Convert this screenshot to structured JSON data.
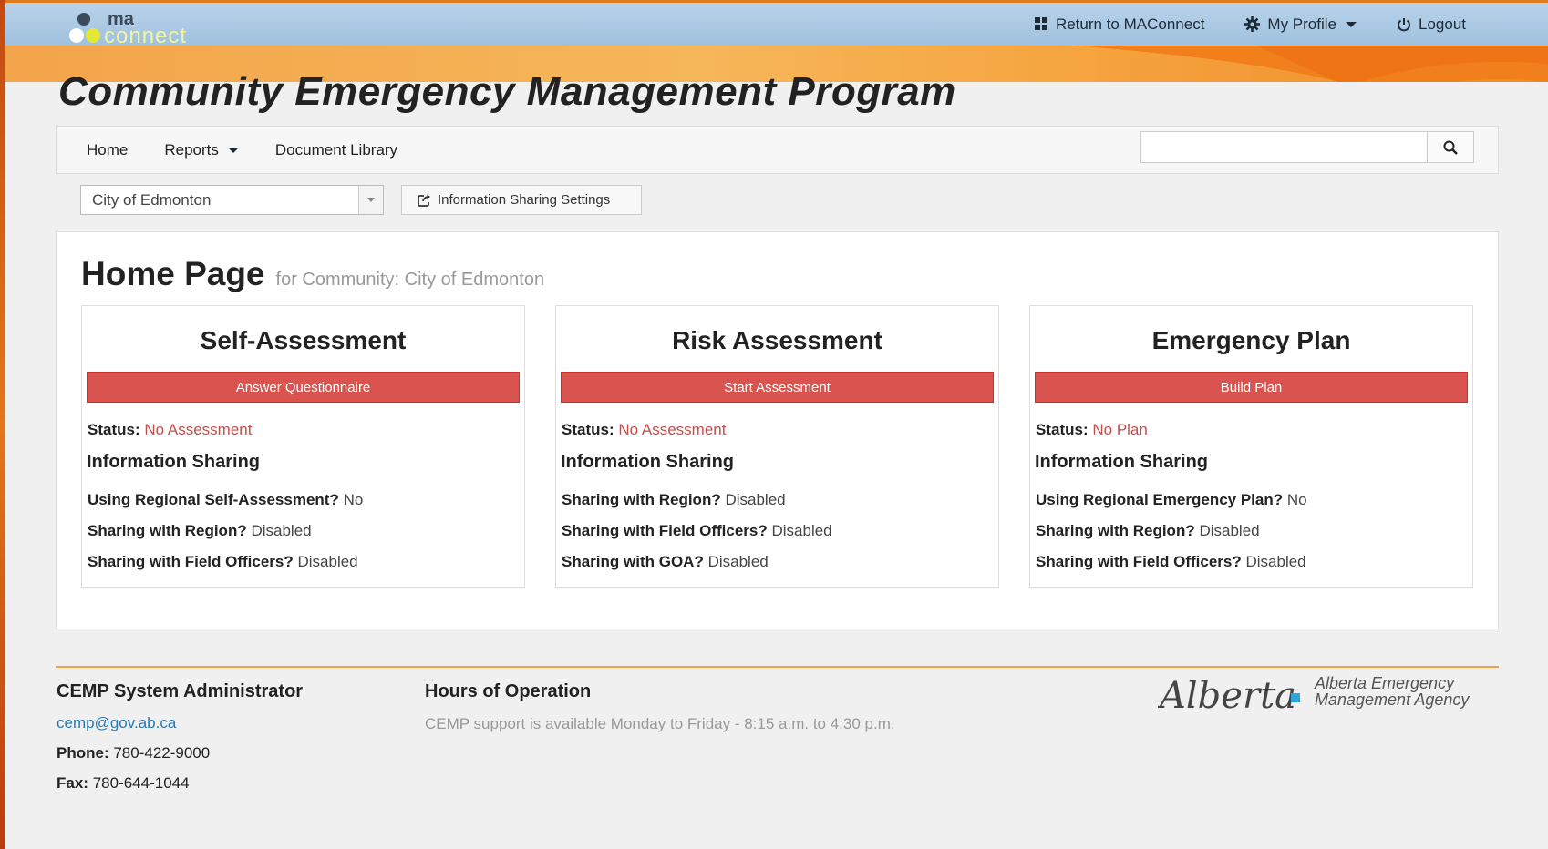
{
  "topbar": {
    "logo_text_top": "ma",
    "logo_text_bottom": "connect",
    "return_label": "Return to MAConnect",
    "profile_label": "My Profile",
    "logout_label": "Logout"
  },
  "app_title": "Community Emergency Management Program",
  "navbar": {
    "home": "Home",
    "reports": "Reports",
    "document_library": "Document Library",
    "search_placeholder": ""
  },
  "controls": {
    "community_selected": "City of Edmonton",
    "sharing_settings_label": "Information Sharing Settings"
  },
  "page": {
    "title": "Home Page",
    "subtitle": "for Community: City of Edmonton"
  },
  "cards": [
    {
      "title": "Self-Assessment",
      "action": "Answer Questionnaire",
      "status_label": "Status:",
      "status_value": "No Assessment",
      "info_heading": "Information Sharing",
      "rows": [
        {
          "label": "Using Regional Self-Assessment?",
          "value": "No"
        },
        {
          "label": "Sharing with Region?",
          "value": "Disabled"
        },
        {
          "label": "Sharing with Field Officers?",
          "value": "Disabled"
        }
      ]
    },
    {
      "title": "Risk Assessment",
      "action": "Start Assessment",
      "status_label": "Status:",
      "status_value": "No Assessment",
      "info_heading": "Information Sharing",
      "rows": [
        {
          "label": "Sharing with Region?",
          "value": "Disabled"
        },
        {
          "label": "Sharing with Field Officers?",
          "value": "Disabled"
        },
        {
          "label": "Sharing with GOA?",
          "value": "Disabled"
        }
      ]
    },
    {
      "title": "Emergency Plan",
      "action": "Build Plan",
      "status_label": "Status:",
      "status_value": "No Plan",
      "info_heading": "Information Sharing",
      "rows": [
        {
          "label": "Using Regional Emergency Plan?",
          "value": "No"
        },
        {
          "label": "Sharing with Region?",
          "value": "Disabled"
        },
        {
          "label": "Sharing with Field Officers?",
          "value": "Disabled"
        }
      ]
    }
  ],
  "footer": {
    "admin_heading": "CEMP System Administrator",
    "email": "cemp@gov.ab.ca",
    "phone_label": "Phone:",
    "phone": "780-422-9000",
    "fax_label": "Fax:",
    "fax": "780-644-1044",
    "hours_heading": "Hours of Operation",
    "hours_text": "CEMP support is available Monday to Friday - 8:15 a.m. to 4:30 p.m.",
    "agency_script": "Alberta",
    "agency_line1": "Alberta Emergency",
    "agency_line2": "Management Agency"
  },
  "colors": {
    "topbar": "#a8c8e4",
    "banner": "#f5a843",
    "action_button": "#d9534f",
    "status_value": "#c0504d",
    "link": "#2a7ab0"
  }
}
